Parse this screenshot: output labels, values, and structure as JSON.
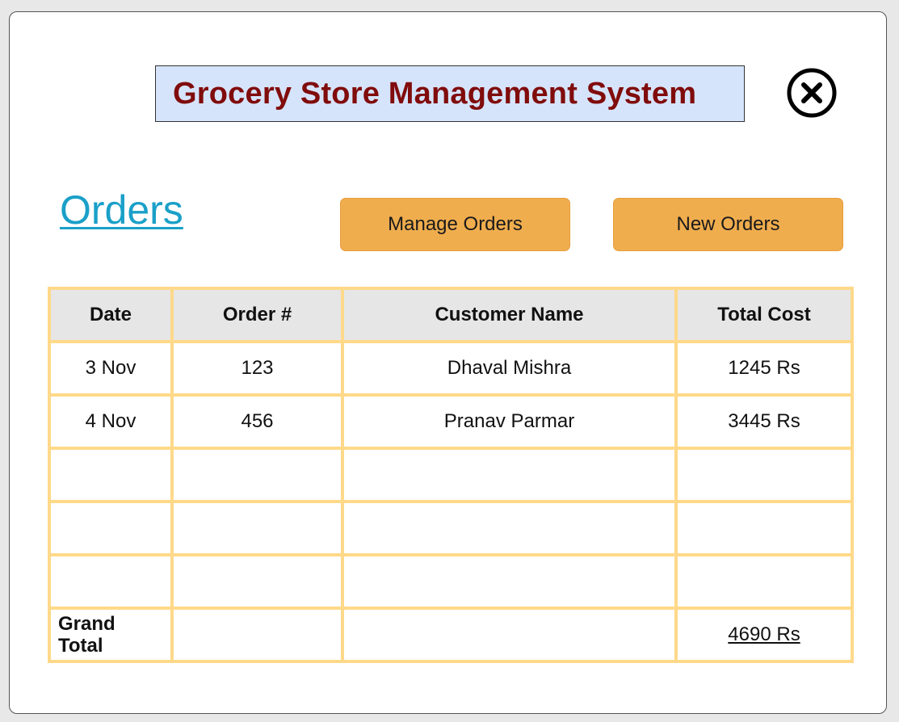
{
  "app": {
    "title": "Grocery Store Management System"
  },
  "colors": {
    "title_text": "#800c0c",
    "title_bg": "#d6e4fb",
    "link": "#1aa0c8",
    "button_bg": "#f0ad4e",
    "table_border": "#ffd98a",
    "header_bg": "#e6e6e6"
  },
  "icons": {
    "close": "close-circle-x-icon"
  },
  "orders_section": {
    "heading": "Orders",
    "buttons": {
      "manage": "Manage Orders",
      "new": "New Orders"
    }
  },
  "table": {
    "columns": [
      "Date",
      "Order #",
      "Customer Name",
      "Total Cost"
    ],
    "rows": [
      {
        "date": "3 Nov",
        "order": "123",
        "customer": "Dhaval Mishra",
        "total": "1245 Rs"
      },
      {
        "date": "4 Nov",
        "order": "456",
        "customer": "Pranav Parmar",
        "total": "3445 Rs"
      },
      {
        "date": "",
        "order": "",
        "customer": "",
        "total": ""
      },
      {
        "date": "",
        "order": "",
        "customer": "",
        "total": ""
      },
      {
        "date": "",
        "order": "",
        "customer": "",
        "total": ""
      }
    ],
    "grand_total": {
      "label_line1": "Grand",
      "label_line2": "Total",
      "value": "4690 Rs"
    }
  }
}
